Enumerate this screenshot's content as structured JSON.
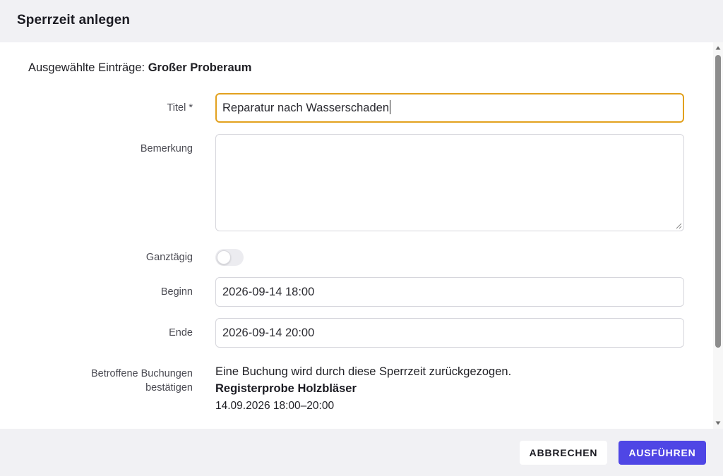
{
  "dialog": {
    "title": "Sperrzeit anlegen"
  },
  "selected": {
    "prefix": "Ausgewählte Einträge:",
    "value": "Großer Proberaum"
  },
  "form": {
    "title": {
      "label": "Titel *",
      "value": "Reparatur nach Wasserschaden"
    },
    "remark": {
      "label": "Bemerkung",
      "value": ""
    },
    "all_day": {
      "label": "Ganztägig",
      "checked": false
    },
    "start": {
      "label": "Beginn",
      "value": "2026-09-14 18:00"
    },
    "end": {
      "label": "Ende",
      "value": "2026-09-14 20:00"
    },
    "affected": {
      "label_line1": "Betroffene Buchungen",
      "label_line2": "bestätigen",
      "message": "Eine Buchung wird durch diese Sperrzeit zurückgezogen.",
      "booking_name": "Registerprobe Holzbläser",
      "booking_time": "14.09.2026 18:00–20:00"
    }
  },
  "footer": {
    "cancel_label": "ABBRECHEN",
    "submit_label": "AUSFÜHREN"
  },
  "colors": {
    "accent": "#4f46e5",
    "focus_border": "#e2a11e",
    "header_bg": "#f1f1f4"
  }
}
